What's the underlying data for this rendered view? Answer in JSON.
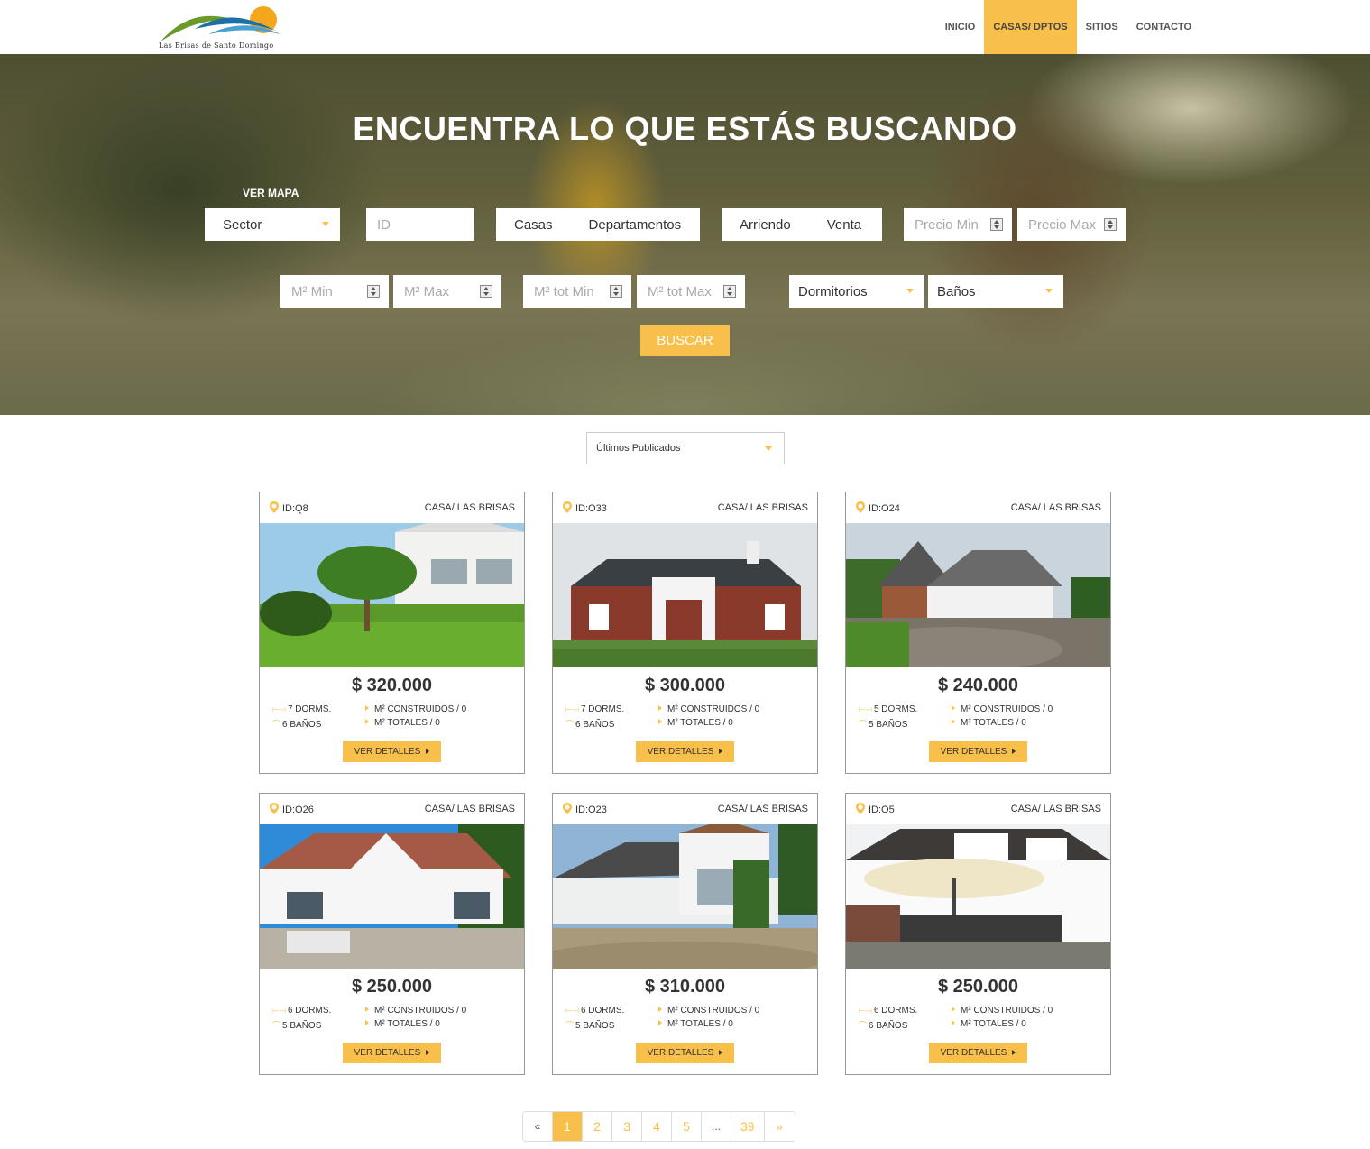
{
  "header": {
    "logo_text": "Las Brisas de Santo Domingo",
    "nav": [
      {
        "label": "INICIO",
        "active": false
      },
      {
        "label": "CASAS/ DPTOS",
        "active": true
      },
      {
        "label": "SITIOS",
        "active": false
      },
      {
        "label": "CONTACTO",
        "active": false
      }
    ]
  },
  "hero": {
    "title": "ENCUENTRA LO QUE ESTÁS BUSCANDO",
    "ver_mapa": "VER MAPA",
    "sector_label": "Sector",
    "id_placeholder": "ID",
    "tipo": {
      "casas": "Casas",
      "departamentos": "Departamentos"
    },
    "operacion": {
      "arriendo": "Arriendo",
      "venta": "Venta"
    },
    "precio_min": "Precio Min",
    "precio_max": "Precio Max",
    "m2_min": "M² Min",
    "m2_max": "M² Max",
    "m2_tot_min": "M² tot Min",
    "m2_tot_max": "M² tot Max",
    "dormitorios": "Dormitorios",
    "banos": "Baños",
    "buscar": "BUSCAR"
  },
  "sort": {
    "value": "Últimos Publicados"
  },
  "accent_color": "#f8c04b",
  "cards": [
    {
      "id": "ID:Q8",
      "type": "CASA/ LAS BRISAS",
      "price": "$ 320.000",
      "dorms": "7 DORMS.",
      "banos": "6 BAÑOS",
      "m2c": "M² CONSTRUIDOS / 0",
      "m2t": "M² TOTALES / 0",
      "btn": "VER DETALLES"
    },
    {
      "id": "ID:O33",
      "type": "CASA/ LAS BRISAS",
      "price": "$ 300.000",
      "dorms": "7 DORMS.",
      "banos": "6 BAÑOS",
      "m2c": "M² CONSTRUIDOS / 0",
      "m2t": "M² TOTALES / 0",
      "btn": "VER DETALLES"
    },
    {
      "id": "ID:O24",
      "type": "CASA/ LAS BRISAS",
      "price": "$ 240.000",
      "dorms": "5 DORMS.",
      "banos": "5 BAÑOS",
      "m2c": "M² CONSTRUIDOS / 0",
      "m2t": "M² TOTALES / 0",
      "btn": "VER DETALLES"
    },
    {
      "id": "ID:O26",
      "type": "CASA/ LAS BRISAS",
      "price": "$ 250.000",
      "dorms": "6 DORMS.",
      "banos": "5 BAÑOS",
      "m2c": "M² CONSTRUIDOS / 0",
      "m2t": "M² TOTALES / 0",
      "btn": "VER DETALLES"
    },
    {
      "id": "ID:O23",
      "type": "CASA/ LAS BRISAS",
      "price": "$ 310.000",
      "dorms": "6 DORMS.",
      "banos": "5 BAÑOS",
      "m2c": "M² CONSTRUIDOS / 0",
      "m2t": "M² TOTALES / 0",
      "btn": "VER DETALLES"
    },
    {
      "id": "ID:O5",
      "type": "CASA/ LAS BRISAS",
      "price": "$ 250.000",
      "dorms": "6 DORMS.",
      "banos": "6 BAÑOS",
      "m2c": "M² CONSTRUIDOS / 0",
      "m2t": "M² TOTALES / 0",
      "btn": "VER DETALLES"
    }
  ],
  "pagination": {
    "prev": "«",
    "pages": [
      "1",
      "2",
      "3",
      "4",
      "5",
      "...",
      "39"
    ],
    "active": "1",
    "next": "»"
  }
}
